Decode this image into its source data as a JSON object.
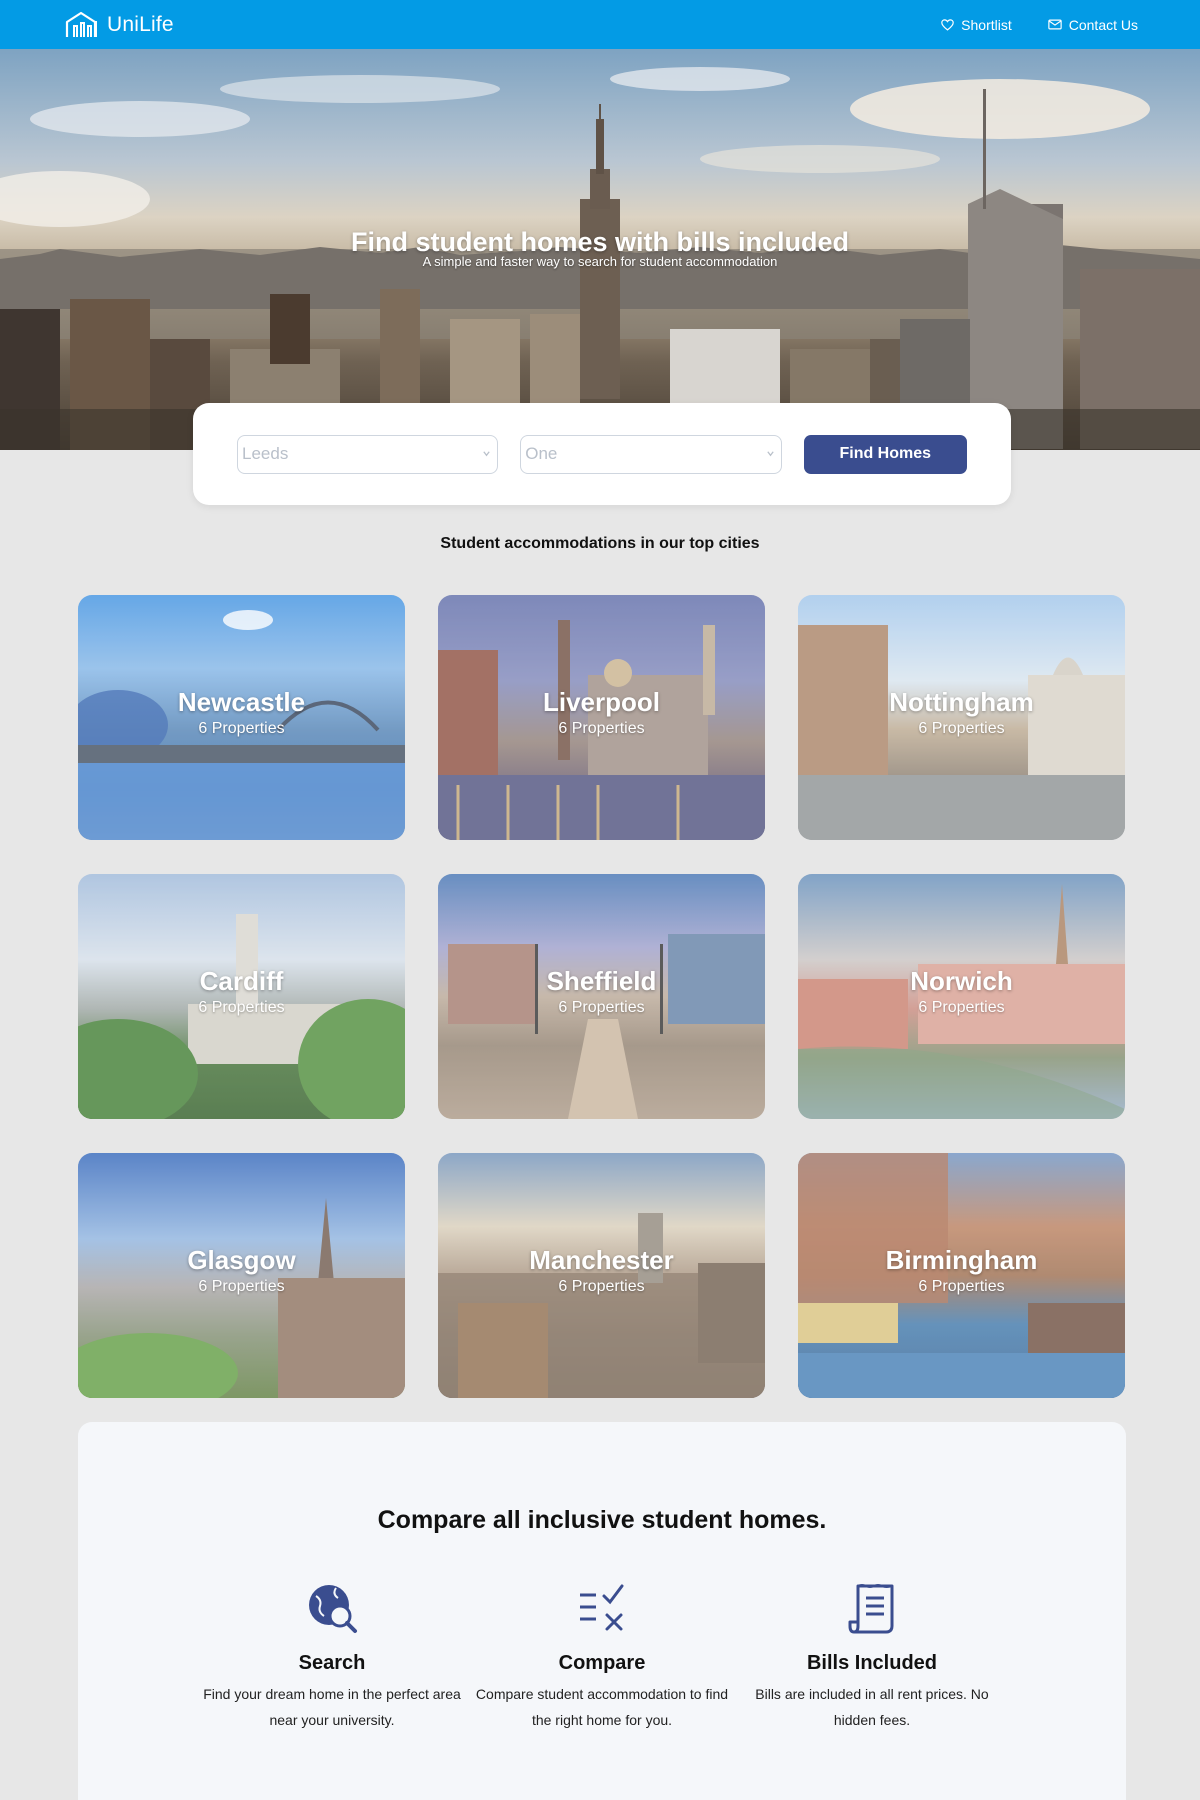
{
  "header": {
    "brand": "UniLife",
    "nav": [
      {
        "label": "Shortlist",
        "icon": "heart-icon"
      },
      {
        "label": "Contact Us",
        "icon": "mail-icon"
      }
    ],
    "color": "#039be5"
  },
  "hero": {
    "title": "Find student homes with bills included",
    "subtitle": "A simple and faster way to search for student accommodation"
  },
  "search": {
    "city_value": "Leeds",
    "bedrooms_value": "One",
    "button_label": "Find Homes",
    "button_color": "#3a4d8f"
  },
  "cities_section": {
    "title": "Student accommodations in our top cities"
  },
  "cities": [
    {
      "name": "Newcastle",
      "properties": "6 Properties"
    },
    {
      "name": "Liverpool",
      "properties": "6 Properties"
    },
    {
      "name": "Nottingham",
      "properties": "6 Properties"
    },
    {
      "name": "Cardiff",
      "properties": "6 Properties"
    },
    {
      "name": "Sheffield",
      "properties": "6 Properties"
    },
    {
      "name": "Norwich",
      "properties": "6 Properties"
    },
    {
      "name": "Glasgow",
      "properties": "6 Properties"
    },
    {
      "name": "Manchester",
      "properties": "6 Properties"
    },
    {
      "name": "Birmingham",
      "properties": "6 Properties"
    }
  ],
  "compare": {
    "title": "Compare all inclusive student homes.",
    "features": [
      {
        "title": "Search",
        "text": "Find your dream home in the perfect area near your university.",
        "icon": "globe-search-icon"
      },
      {
        "title": "Compare",
        "text": "Compare student accommodation to find the right home for you.",
        "icon": "compare-icon"
      },
      {
        "title": "Bills Included",
        "text": "Bills are included in all rent prices. No hidden fees.",
        "icon": "document-icon"
      }
    ]
  }
}
